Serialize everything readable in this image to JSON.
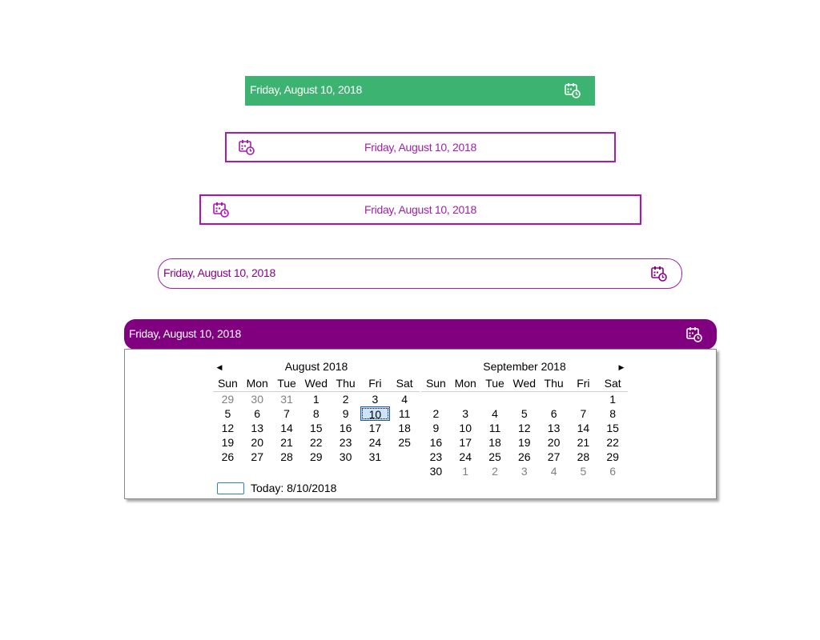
{
  "pickers": [
    {
      "value": "Friday, August 10, 2018",
      "bg": "#3cb371",
      "fg": "#ffffff",
      "icon": "calendar-clock-icon"
    },
    {
      "value": "Friday, August 10, 2018",
      "border": "#a020a8",
      "fg": "#a020a8",
      "icon": "calendar-clock-icon"
    },
    {
      "value": "Friday, August 10, 2018",
      "border": "#b010b8",
      "fg": "#a020a8",
      "icon": "calendar-clock-icon"
    },
    {
      "value": "Friday, August 10, 2018",
      "border": "#a020a8",
      "fg": "#8b008b",
      "icon": "calendar-clock-icon"
    },
    {
      "value": "Friday, August 10, 2018",
      "bg": "#800080",
      "fg": "#ffffff",
      "icon": "calendar-clock-icon"
    }
  ],
  "calendar": {
    "prev_icon": "◀",
    "next_icon": "▶",
    "days_of_week": [
      "Sun",
      "Mon",
      "Tue",
      "Wed",
      "Thu",
      "Fri",
      "Sat"
    ],
    "selected_color": "#cce4f7",
    "months": [
      {
        "title": "August 2018",
        "weeks": [
          [
            {
              "d": "29",
              "t": true
            },
            {
              "d": "30",
              "t": true
            },
            {
              "d": "31",
              "t": true
            },
            {
              "d": "1"
            },
            {
              "d": "2"
            },
            {
              "d": "3"
            },
            {
              "d": "4"
            }
          ],
          [
            {
              "d": "5"
            },
            {
              "d": "6"
            },
            {
              "d": "7"
            },
            {
              "d": "8"
            },
            {
              "d": "9"
            },
            {
              "d": "10",
              "sel": true
            },
            {
              "d": "11"
            }
          ],
          [
            {
              "d": "12"
            },
            {
              "d": "13"
            },
            {
              "d": "14"
            },
            {
              "d": "15"
            },
            {
              "d": "16"
            },
            {
              "d": "17"
            },
            {
              "d": "18"
            }
          ],
          [
            {
              "d": "19"
            },
            {
              "d": "20"
            },
            {
              "d": "21"
            },
            {
              "d": "22"
            },
            {
              "d": "23"
            },
            {
              "d": "24"
            },
            {
              "d": "25"
            }
          ],
          [
            {
              "d": "26"
            },
            {
              "d": "27"
            },
            {
              "d": "28"
            },
            {
              "d": "29"
            },
            {
              "d": "30"
            },
            {
              "d": "31"
            },
            {
              "d": ""
            }
          ],
          [
            {
              "d": ""
            },
            {
              "d": ""
            },
            {
              "d": ""
            },
            {
              "d": ""
            },
            {
              "d": ""
            },
            {
              "d": ""
            },
            {
              "d": ""
            }
          ]
        ]
      },
      {
        "title": "September 2018",
        "weeks": [
          [
            {
              "d": ""
            },
            {
              "d": ""
            },
            {
              "d": ""
            },
            {
              "d": ""
            },
            {
              "d": ""
            },
            {
              "d": ""
            },
            {
              "d": "1"
            }
          ],
          [
            {
              "d": "2"
            },
            {
              "d": "3"
            },
            {
              "d": "4"
            },
            {
              "d": "5"
            },
            {
              "d": "6"
            },
            {
              "d": "7"
            },
            {
              "d": "8"
            }
          ],
          [
            {
              "d": "9"
            },
            {
              "d": "10"
            },
            {
              "d": "11"
            },
            {
              "d": "12"
            },
            {
              "d": "13"
            },
            {
              "d": "14"
            },
            {
              "d": "15"
            }
          ],
          [
            {
              "d": "16"
            },
            {
              "d": "17"
            },
            {
              "d": "18"
            },
            {
              "d": "19"
            },
            {
              "d": "20"
            },
            {
              "d": "21"
            },
            {
              "d": "22"
            }
          ],
          [
            {
              "d": "23"
            },
            {
              "d": "24"
            },
            {
              "d": "25"
            },
            {
              "d": "26"
            },
            {
              "d": "27"
            },
            {
              "d": "28"
            },
            {
              "d": "29"
            }
          ],
          [
            {
              "d": "30"
            },
            {
              "d": "1",
              "t": true
            },
            {
              "d": "2",
              "t": true
            },
            {
              "d": "3",
              "t": true
            },
            {
              "d": "4",
              "t": true
            },
            {
              "d": "5",
              "t": true
            },
            {
              "d": "6",
              "t": true
            }
          ]
        ]
      }
    ],
    "today_label": "Today: 8/10/2018"
  }
}
